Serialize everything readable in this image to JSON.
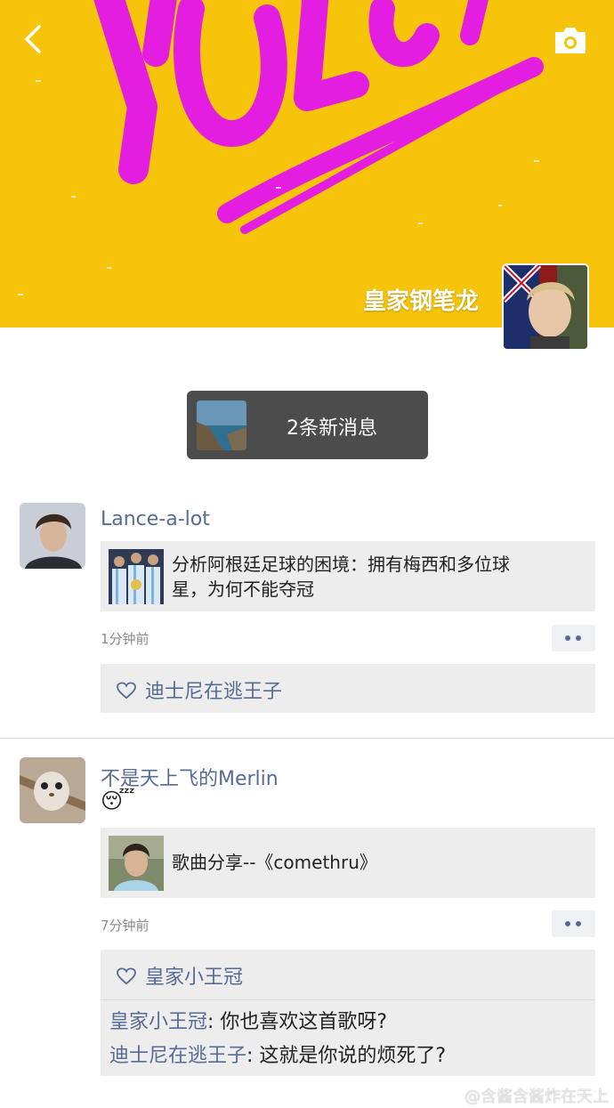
{
  "cover": {
    "art_text": "YOLO!",
    "owner_name": "皇家钢笔龙",
    "colors": {
      "background": "#f6c40b",
      "art": "#e41ee0"
    }
  },
  "header": {
    "back_icon": "chevron-left-icon",
    "camera_icon": "camera-icon"
  },
  "notification": {
    "label": "2条新消息"
  },
  "posts": [
    {
      "nickname": "Lance-a-lot",
      "link_title_line1": "分析阿根廷足球的困境：拥有梅西和多位球",
      "link_title_line2": "星，为何不能夺冠",
      "time": "1分钟前",
      "likes": "迪士尼在逃王子",
      "comments": []
    },
    {
      "nickname": "不是天上飞的Merlin",
      "emoji": "😴",
      "link_title_line1": "歌曲分享--《comethru》",
      "time": "7分钟前",
      "likes": "皇家小王冠",
      "comments": [
        {
          "author": "皇家小王冠",
          "text": ": 你也喜欢这首歌呀?"
        },
        {
          "author": "迪士尼在逃王子",
          "text": ": 这就是你说的烦死了?"
        }
      ]
    }
  ],
  "footer": {
    "watermark": "@含酱含酱炸在天上"
  },
  "theme": {
    "link_color": "#576b95",
    "card_bg": "#ededed"
  }
}
